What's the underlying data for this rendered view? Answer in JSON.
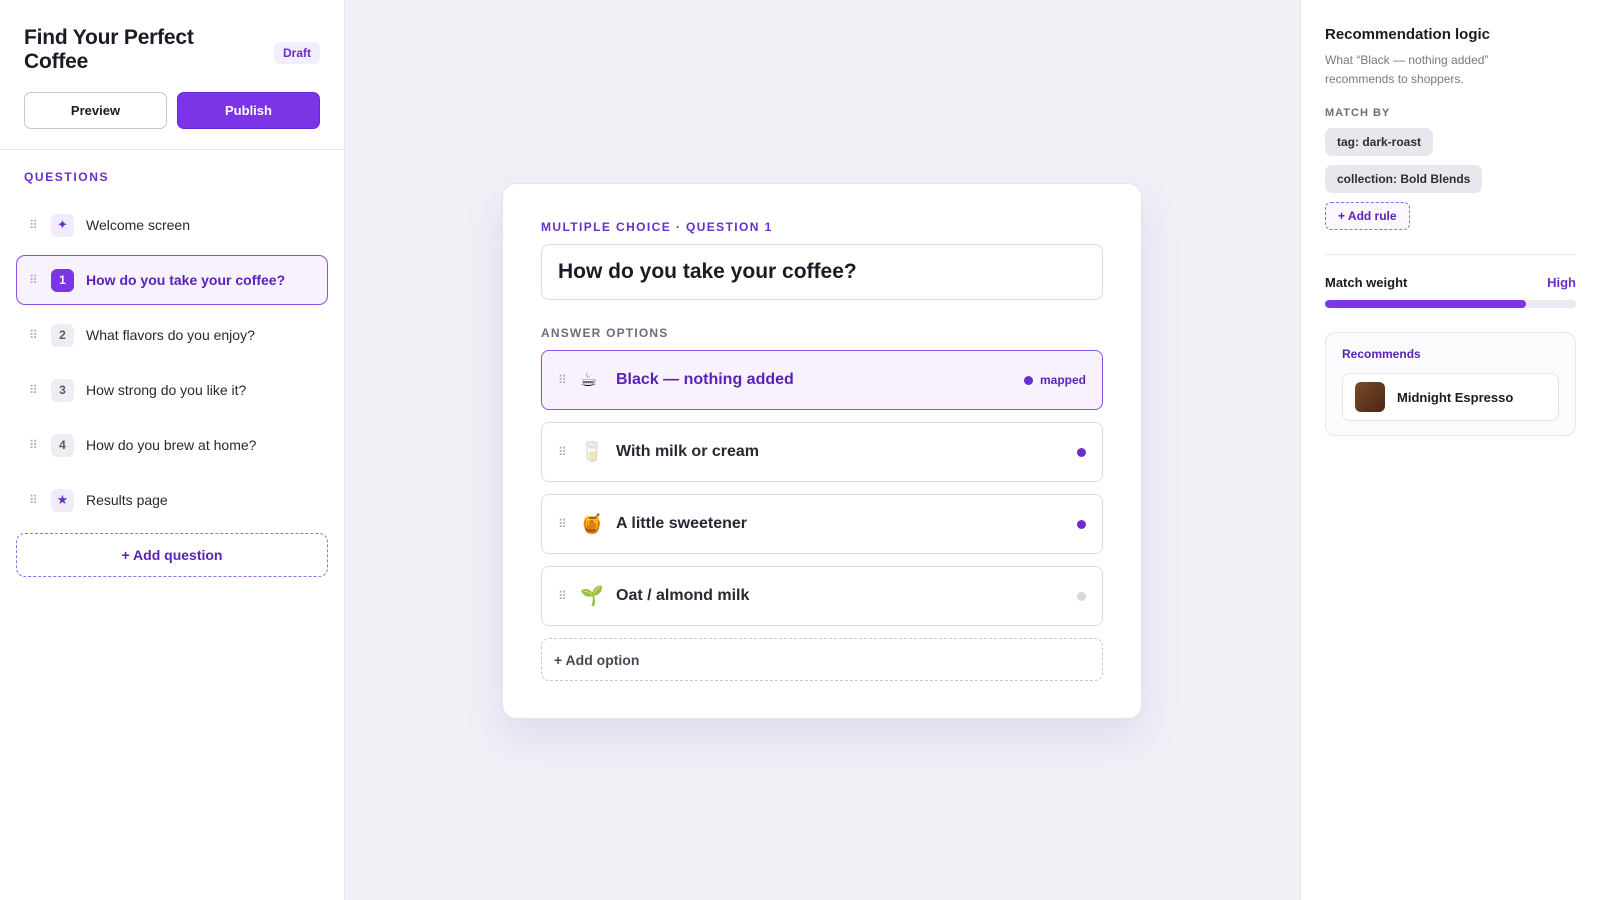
{
  "quiz": {
    "title": "Find Your Perfect Coffee",
    "status": "Draft",
    "preview_label": "Preview",
    "publish_label": "Publish"
  },
  "questions_section": {
    "label": "QUESTIONS",
    "items": [
      {
        "badge": "✦",
        "label": "Welcome screen"
      },
      {
        "badge": "1",
        "label": "How do you take your coffee?"
      },
      {
        "badge": "2",
        "label": "What flavors do you enjoy?"
      },
      {
        "badge": "3",
        "label": "How strong do you like it?"
      },
      {
        "badge": "4",
        "label": "How do you brew at home?"
      },
      {
        "badge": "★",
        "label": "Results page"
      }
    ],
    "add_label": "+ Add question"
  },
  "editor": {
    "question_type": "MULTIPLE CHOICE · QUESTION 1",
    "question_text": "How do you take your coffee?",
    "answers_label": "ANSWER OPTIONS",
    "options": [
      {
        "emoji": "☕",
        "label": "Black — nothing added",
        "status": "mapped"
      },
      {
        "emoji": "🥛",
        "label": "With milk or cream"
      },
      {
        "emoji": "🍯",
        "label": "A little sweetener"
      },
      {
        "emoji": "🌱",
        "label": "Oat / almond milk"
      }
    ],
    "add_option_label": "+ Add option"
  },
  "logic": {
    "title": "Recommendation logic",
    "description": "What “Black — nothing added” recommends to shoppers.",
    "match_by_label": "MATCH BY",
    "rules": [
      "tag: dark-roast",
      "collection: Bold Blends"
    ],
    "add_rule_label": "+ Add rule",
    "weight_label": "Match weight",
    "weight_value": "High",
    "weight_fraction": 0.8,
    "recommends_label": "Recommends",
    "product_name": "Midnight Espresso"
  },
  "colors": {
    "accent": "#7b35e6",
    "accent_dark": "#5b22b8",
    "mapped_dot": "#6b2fc9",
    "unmapped_dot": "#d9d7df"
  },
  "icons": {
    "drag": "drag-handle-icon",
    "welcome": "sparkle-icon",
    "results": "star-icon"
  }
}
